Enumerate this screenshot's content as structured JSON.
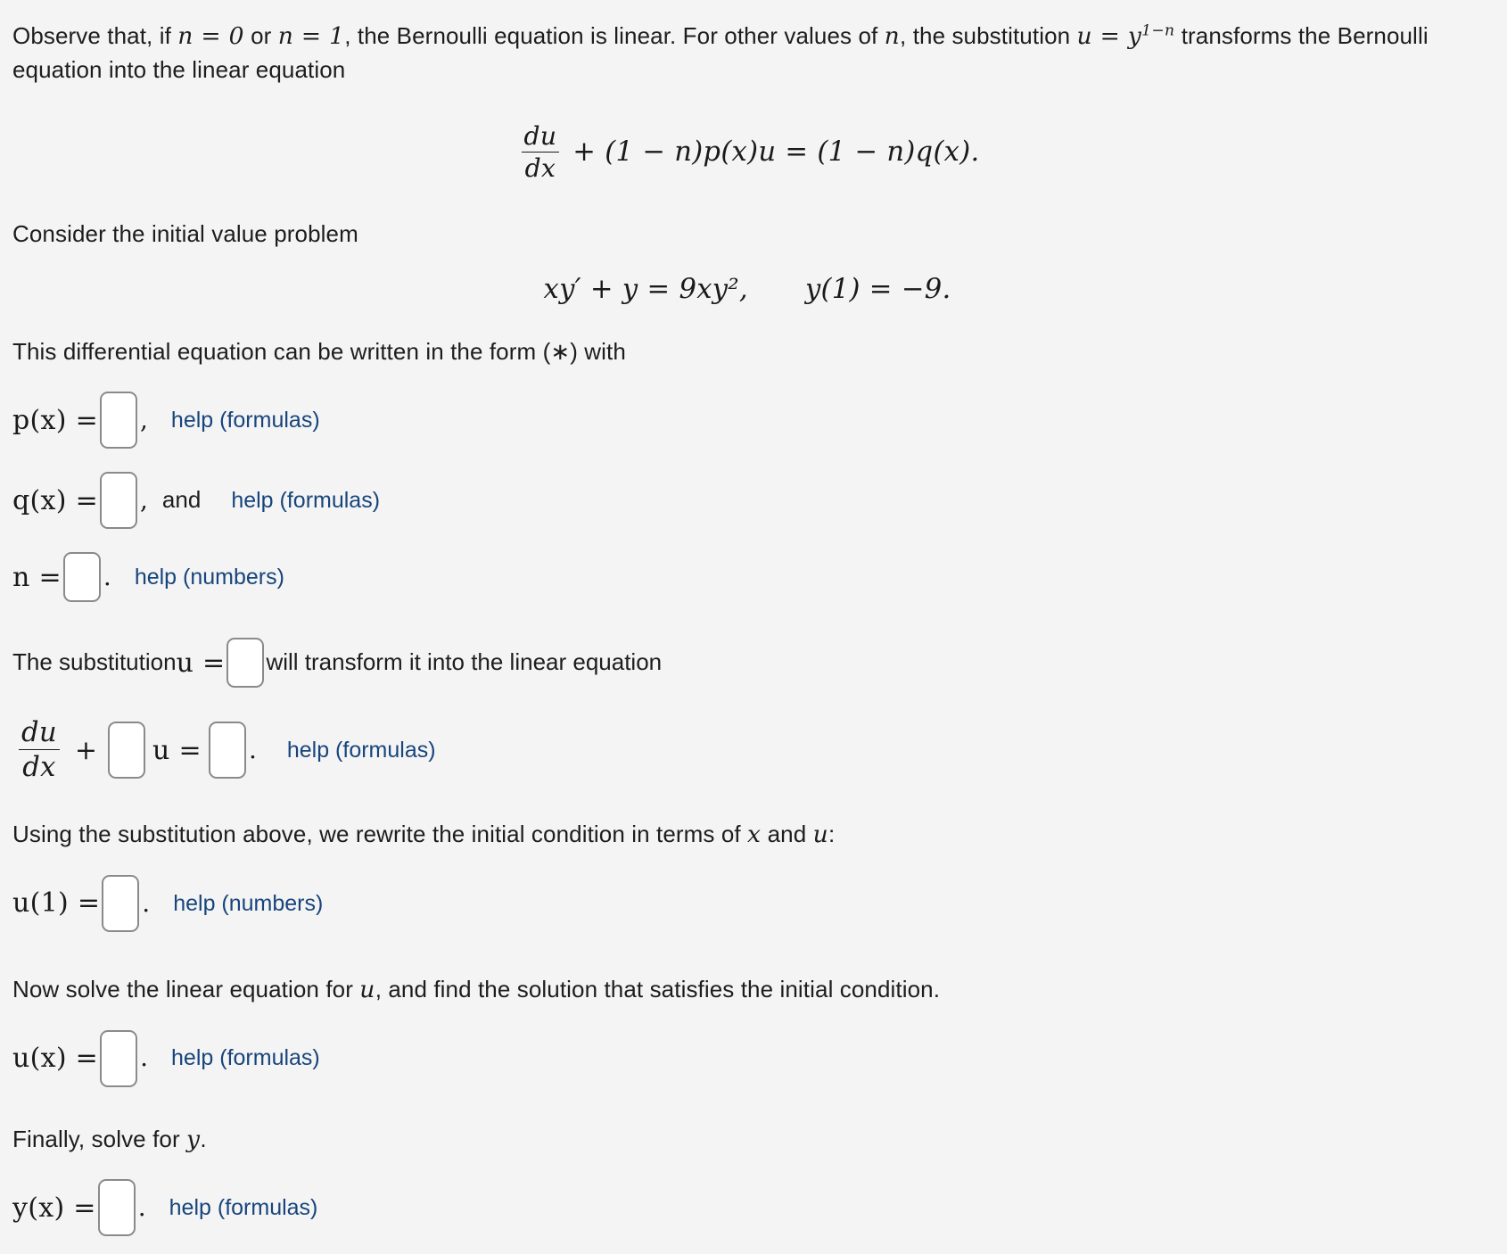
{
  "document": {
    "intro": {
      "text_before_n0": "Observe that, if ",
      "n_eq_0": "n = 0",
      "text_or": " or ",
      "n_eq_1": "n = 1",
      "text_middle": ", the Bernoulli equation is linear. For other values of ",
      "n_var": "n",
      "text_substitution": ", the substitution ",
      "u_eq": "u = y",
      "exponent": "1−n",
      "text_after": " transforms the Bernoulli equation into the linear equation"
    },
    "equation_linear": {
      "fraction_numerator": "du",
      "fraction_denominator": "dx",
      "rest": "+ (1 − n)p(x)u = (1 − n)q(x)."
    },
    "consider_line": "Consider the initial value problem",
    "ivp": {
      "ode": "xy′ + y = 9xy²,",
      "initial_condition": "y(1) = −9."
    },
    "form_line": "This differential equation can be written in the form (∗) with",
    "fields": {
      "p_label": "p(x) =",
      "p_value": "",
      "p_comma": ",",
      "p_help": "help (formulas)",
      "q_label": "q(x) =",
      "q_value": "",
      "q_comma": ",",
      "q_and": "and",
      "q_help": "help (formulas)",
      "n_label": "n =",
      "n_value": "",
      "n_period": ".",
      "n_help": "help (numbers)"
    },
    "substitution_line": {
      "prefix": "The substitution ",
      "u_eq": "u =",
      "value": "",
      "suffix": "will transform it into the linear equation"
    },
    "linear_equation_row": {
      "fraction_numerator": "du",
      "fraction_denominator": "dx",
      "plus": "+",
      "coefficient_value": "",
      "u_symbol": "u =",
      "rhs_value": "",
      "period": ".",
      "help": "help (formulas)"
    },
    "rewrite_line": {
      "prefix": "Using the substitution above, we rewrite the initial condition in terms of ",
      "x_var": "x",
      "and_word": " and ",
      "u_var": "u",
      "colon": ":"
    },
    "u_initial": {
      "label": "u(1) =",
      "value": "",
      "period": ".",
      "help": "help (numbers)"
    },
    "solve_line": {
      "prefix": "Now solve the linear equation for ",
      "u_var": "u",
      "suffix": ", and find the solution that satisfies the initial condition."
    },
    "u_solution": {
      "label": "u(x) =",
      "value": "",
      "period": ".",
      "help": "help (formulas)"
    },
    "finally_line": {
      "prefix": "Finally, solve for ",
      "y_var": "y",
      "suffix": "."
    },
    "y_solution": {
      "label": "y(x) =",
      "value": "",
      "period": ".",
      "help": "help (formulas)"
    }
  },
  "colors": {
    "page_background": "#f4f4f4",
    "text": "#1d1d1d",
    "link": "#17457c",
    "input_border": "#8a8a8a",
    "input_background": "#ffffff"
  }
}
